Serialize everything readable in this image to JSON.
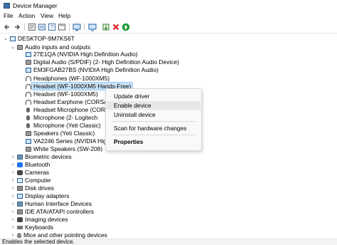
{
  "window": {
    "title": "Device Manager"
  },
  "menu": [
    "File",
    "Action",
    "View",
    "Help"
  ],
  "toolbar": {
    "buttons": [
      "back-icon",
      "forward-icon",
      "properties-icon",
      "help-icon",
      "scan-icon",
      "monitor-icon",
      "update-driver-icon",
      "uninstall-icon",
      "enable-icon"
    ],
    "colors": {
      "uninstall": "#d9262b",
      "enable": "#1f9d3a"
    }
  },
  "tree": {
    "root": "DESKTOP-9M7KS6T",
    "audio_category": "Audio inputs and outputs",
    "audio_devices": [
      "27E1QA (NVIDIA High Definition Audio)",
      "Digital Audio (S/PDIF) (2- High Definition Audio Device)",
      "EM3FGAB27BS (NVIDIA High Definition Audio)",
      "Headphones (WF-1000XM5)",
      "Headset (WF-1000XM5 Hands-Free)",
      "Headset (WF-1000XM5)",
      "Headset Earphone (CORSA",
      "Headset Microphone (CORS",
      "Microphone (2- Logitech",
      "Microphone (Yeti Classic)",
      "Speakers (Yeti Classic)",
      "VA2246 Series (NVIDIA High",
      "White Speakers (SW-208)"
    ],
    "categories": [
      "Biometric devices",
      "Bluetooth",
      "Cameras",
      "Computer",
      "Disk drives",
      "Display adapters",
      "Human Interface Devices",
      "IDE ATA/ATAPI controllers",
      "Imaging devices",
      "Keyboards",
      "Mice and other pointing devices"
    ]
  },
  "context_menu": {
    "update_driver": "Update driver",
    "enable_device": "Enable device",
    "uninstall_device": "Uninstall device",
    "scan_hardware": "Scan for hardware changes",
    "properties": "Properties"
  },
  "status": {
    "text": "Enables the selected device."
  }
}
